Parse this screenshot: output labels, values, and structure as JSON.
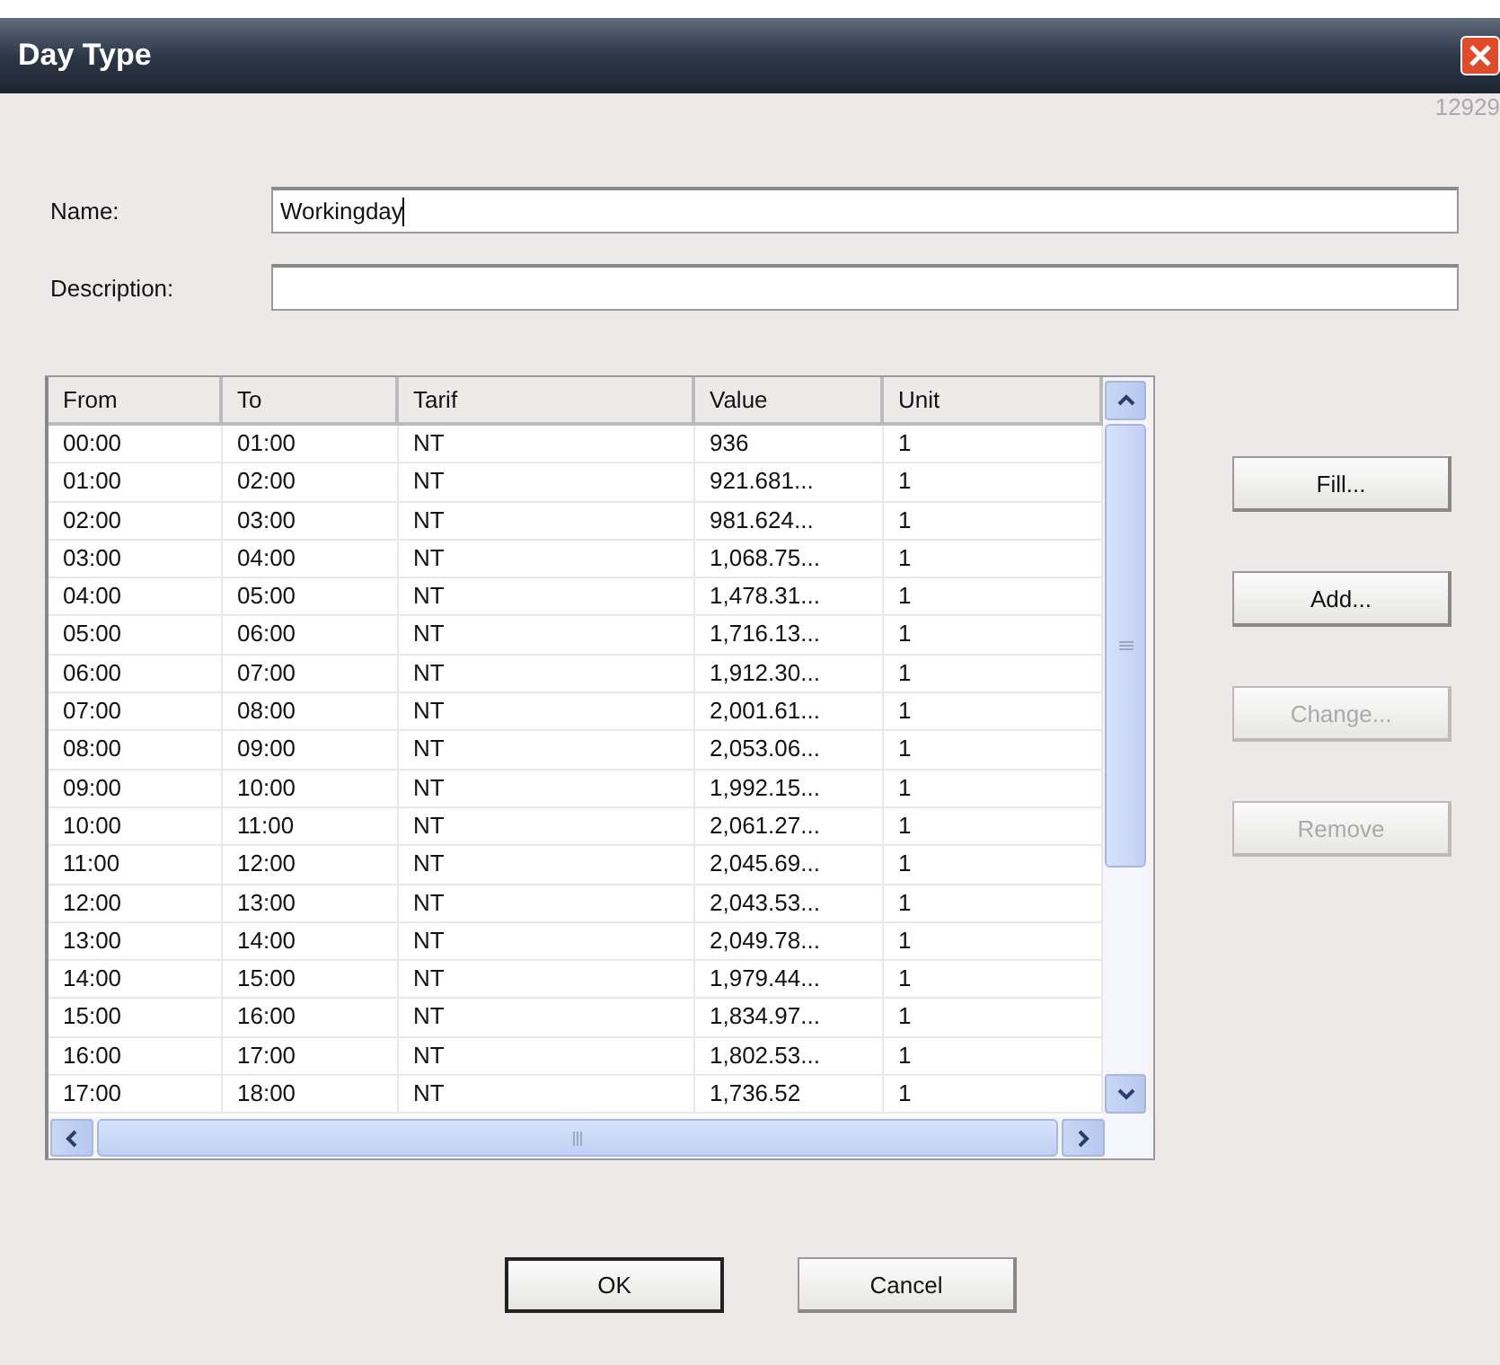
{
  "window": {
    "title": "Day Type",
    "corner_text": "12929"
  },
  "form": [
    {
      "label": "Name:",
      "value": "Workingday"
    },
    {
      "label": "Description:"
    }
  ],
  "table": {
    "columns": [
      "From",
      "To",
      "Tarif",
      "Value",
      "Unit"
    ],
    "rows": [
      [
        "00:00",
        "01:00",
        "NT",
        "936",
        "1"
      ],
      [
        "01:00",
        "02:00",
        "NT",
        "921.681...",
        "1"
      ],
      [
        "02:00",
        "03:00",
        "NT",
        "981.624...",
        "1"
      ],
      [
        "03:00",
        "04:00",
        "NT",
        "1,068.75...",
        "1"
      ],
      [
        "04:00",
        "05:00",
        "NT",
        "1,478.31...",
        "1"
      ],
      [
        "05:00",
        "06:00",
        "NT",
        "1,716.13...",
        "1"
      ],
      [
        "06:00",
        "07:00",
        "NT",
        "1,912.30...",
        "1"
      ],
      [
        "07:00",
        "08:00",
        "NT",
        "2,001.61...",
        "1"
      ],
      [
        "08:00",
        "09:00",
        "NT",
        "2,053.06...",
        "1"
      ],
      [
        "09:00",
        "10:00",
        "NT",
        "1,992.15...",
        "1"
      ],
      [
        "10:00",
        "11:00",
        "NT",
        "2,061.27...",
        "1"
      ],
      [
        "11:00",
        "12:00",
        "NT",
        "2,045.69...",
        "1"
      ],
      [
        "12:00",
        "13:00",
        "NT",
        "2,043.53...",
        "1"
      ],
      [
        "13:00",
        "14:00",
        "NT",
        "2,049.78...",
        "1"
      ],
      [
        "14:00",
        "15:00",
        "NT",
        "1,979.44...",
        "1"
      ],
      [
        "15:00",
        "16:00",
        "NT",
        "1,834.97...",
        "1"
      ],
      [
        "16:00",
        "17:00",
        "NT",
        "1,802.53...",
        "1"
      ],
      [
        "17:00",
        "18:00",
        "NT",
        "1,736.52",
        "1"
      ]
    ]
  },
  "side_buttons": [
    {
      "label": "Fill...",
      "disabled": false
    },
    {
      "label": "Add...",
      "disabled": false
    },
    {
      "label": "Change...",
      "disabled": true
    },
    {
      "label": "Remove",
      "disabled": true
    }
  ],
  "buttons": [
    {
      "label": "OK",
      "default": true
    },
    {
      "label": "Cancel",
      "default": false
    }
  ]
}
